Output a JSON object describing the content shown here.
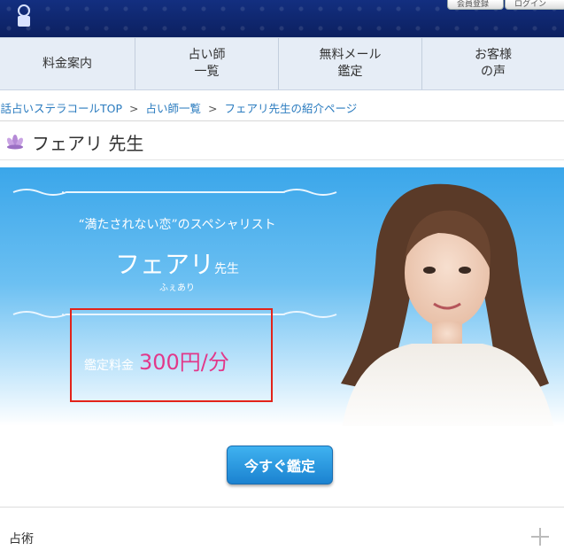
{
  "header": {
    "register_label": "会員登録",
    "login_label": "ログイン"
  },
  "nav": {
    "items": [
      {
        "label": "料金案内"
      },
      {
        "label": "占い師\n一覧"
      },
      {
        "label": "無料メール\n鑑定"
      },
      {
        "label": "お客様\nの声"
      }
    ]
  },
  "breadcrumb": {
    "items": [
      "電話占いステラコールTOP",
      "占い師一覧",
      "フェアリ先生の紹介ページ"
    ],
    "separator": ">"
  },
  "page_title": "フェアリ 先生",
  "profile": {
    "catchphrase": "“満たされない恋”のスペシャリスト",
    "name": "フェアリ",
    "honorific": "先生",
    "kana": "ふぇあり",
    "fee_label": "鑑定料金",
    "fee_value": "300円/分"
  },
  "cta_label": "今すぐ鑑定",
  "section": {
    "label": "占術"
  },
  "colors": {
    "accent_pink": "#e2388a",
    "link_blue": "#2a7bbf",
    "highlight_red": "#e2231a",
    "button_blue": "#1b82d0"
  },
  "icons": {
    "logo": "crest-icon",
    "title": "lotus-icon",
    "expand": "plus-icon"
  }
}
